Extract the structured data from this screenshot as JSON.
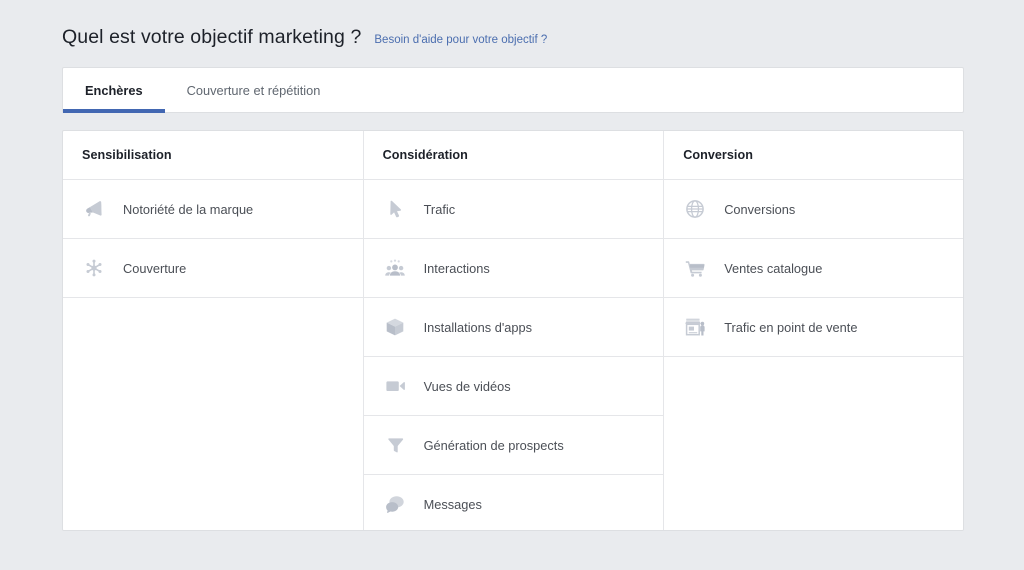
{
  "header": {
    "title": "Quel est votre objectif marketing ?",
    "help_link": "Besoin d'aide pour votre objectif ?",
    "link_color": "#4b6eaf"
  },
  "tabs": {
    "active_index": 0,
    "accent_color": "#4267b2",
    "items": [
      {
        "label": "Enchères"
      },
      {
        "label": "Couverture et répétition"
      }
    ]
  },
  "columns": [
    {
      "header": "Sensibilisation",
      "objectives": [
        {
          "label": "Notoriété de la marque",
          "icon": "megaphone-icon"
        },
        {
          "label": "Couverture",
          "icon": "reach-burst-icon"
        }
      ]
    },
    {
      "header": "Considération",
      "objectives": [
        {
          "label": "Trafic",
          "icon": "cursor-arrow-icon"
        },
        {
          "label": "Interactions",
          "icon": "people-group-icon"
        },
        {
          "label": "Installations d'apps",
          "icon": "box-3d-icon"
        },
        {
          "label": "Vues de vidéos",
          "icon": "video-camera-icon"
        },
        {
          "label": "Génération de prospects",
          "icon": "funnel-icon"
        },
        {
          "label": "Messages",
          "icon": "chat-bubbles-icon"
        }
      ]
    },
    {
      "header": "Conversion",
      "objectives": [
        {
          "label": "Conversions",
          "icon": "globe-icon"
        },
        {
          "label": "Ventes catalogue",
          "icon": "shopping-cart-icon"
        },
        {
          "label": "Trafic en point de vente",
          "icon": "storefront-icon"
        }
      ]
    }
  ]
}
